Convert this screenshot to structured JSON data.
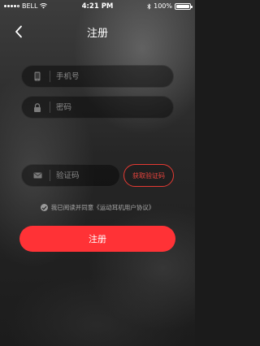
{
  "status_bar": {
    "carrier": "BELL",
    "time": "4:21 PM",
    "battery": "100%",
    "battery_level": 1.0
  },
  "header": {
    "title": "注册",
    "back_icon": "chevron-left-icon"
  },
  "form": {
    "phone": {
      "placeholder": "手机号",
      "value": "",
      "icon": "phone-icon"
    },
    "password": {
      "placeholder": "密码",
      "value": "",
      "icon": "lock-icon"
    },
    "code": {
      "placeholder": "验证码",
      "value": "",
      "icon": "mail-icon"
    },
    "get_code_label": "获取验证码",
    "agreement_text": "我已阅读并同意《运动耳机用户协议》",
    "agreement_checked": true,
    "submit_label": "注册"
  },
  "colors": {
    "accent": "#ff3236",
    "accent_outline": "#e53a33"
  }
}
